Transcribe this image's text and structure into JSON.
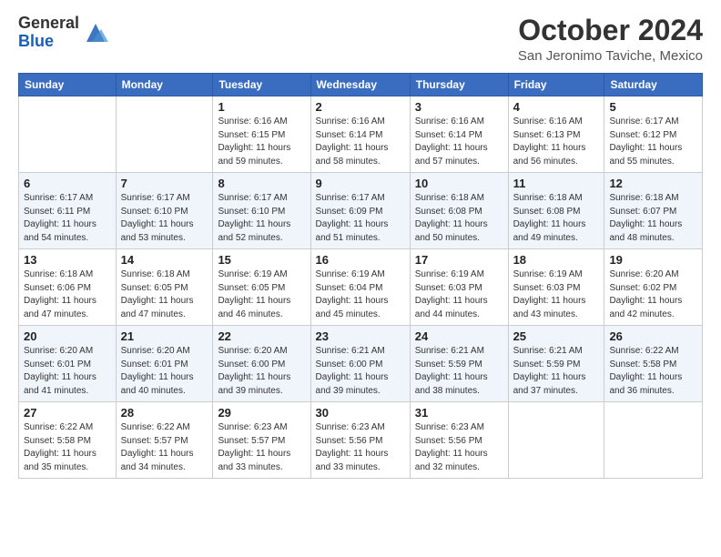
{
  "header": {
    "logo_general": "General",
    "logo_blue": "Blue",
    "month": "October 2024",
    "location": "San Jeronimo Taviche, Mexico"
  },
  "days_of_week": [
    "Sunday",
    "Monday",
    "Tuesday",
    "Wednesday",
    "Thursday",
    "Friday",
    "Saturday"
  ],
  "weeks": [
    [
      {
        "day": "",
        "info": ""
      },
      {
        "day": "",
        "info": ""
      },
      {
        "day": "1",
        "info": "Sunrise: 6:16 AM\nSunset: 6:15 PM\nDaylight: 11 hours and 59 minutes."
      },
      {
        "day": "2",
        "info": "Sunrise: 6:16 AM\nSunset: 6:14 PM\nDaylight: 11 hours and 58 minutes."
      },
      {
        "day": "3",
        "info": "Sunrise: 6:16 AM\nSunset: 6:14 PM\nDaylight: 11 hours and 57 minutes."
      },
      {
        "day": "4",
        "info": "Sunrise: 6:16 AM\nSunset: 6:13 PM\nDaylight: 11 hours and 56 minutes."
      },
      {
        "day": "5",
        "info": "Sunrise: 6:17 AM\nSunset: 6:12 PM\nDaylight: 11 hours and 55 minutes."
      }
    ],
    [
      {
        "day": "6",
        "info": "Sunrise: 6:17 AM\nSunset: 6:11 PM\nDaylight: 11 hours and 54 minutes."
      },
      {
        "day": "7",
        "info": "Sunrise: 6:17 AM\nSunset: 6:10 PM\nDaylight: 11 hours and 53 minutes."
      },
      {
        "day": "8",
        "info": "Sunrise: 6:17 AM\nSunset: 6:10 PM\nDaylight: 11 hours and 52 minutes."
      },
      {
        "day": "9",
        "info": "Sunrise: 6:17 AM\nSunset: 6:09 PM\nDaylight: 11 hours and 51 minutes."
      },
      {
        "day": "10",
        "info": "Sunrise: 6:18 AM\nSunset: 6:08 PM\nDaylight: 11 hours and 50 minutes."
      },
      {
        "day": "11",
        "info": "Sunrise: 6:18 AM\nSunset: 6:08 PM\nDaylight: 11 hours and 49 minutes."
      },
      {
        "day": "12",
        "info": "Sunrise: 6:18 AM\nSunset: 6:07 PM\nDaylight: 11 hours and 48 minutes."
      }
    ],
    [
      {
        "day": "13",
        "info": "Sunrise: 6:18 AM\nSunset: 6:06 PM\nDaylight: 11 hours and 47 minutes."
      },
      {
        "day": "14",
        "info": "Sunrise: 6:18 AM\nSunset: 6:05 PM\nDaylight: 11 hours and 47 minutes."
      },
      {
        "day": "15",
        "info": "Sunrise: 6:19 AM\nSunset: 6:05 PM\nDaylight: 11 hours and 46 minutes."
      },
      {
        "day": "16",
        "info": "Sunrise: 6:19 AM\nSunset: 6:04 PM\nDaylight: 11 hours and 45 minutes."
      },
      {
        "day": "17",
        "info": "Sunrise: 6:19 AM\nSunset: 6:03 PM\nDaylight: 11 hours and 44 minutes."
      },
      {
        "day": "18",
        "info": "Sunrise: 6:19 AM\nSunset: 6:03 PM\nDaylight: 11 hours and 43 minutes."
      },
      {
        "day": "19",
        "info": "Sunrise: 6:20 AM\nSunset: 6:02 PM\nDaylight: 11 hours and 42 minutes."
      }
    ],
    [
      {
        "day": "20",
        "info": "Sunrise: 6:20 AM\nSunset: 6:01 PM\nDaylight: 11 hours and 41 minutes."
      },
      {
        "day": "21",
        "info": "Sunrise: 6:20 AM\nSunset: 6:01 PM\nDaylight: 11 hours and 40 minutes."
      },
      {
        "day": "22",
        "info": "Sunrise: 6:20 AM\nSunset: 6:00 PM\nDaylight: 11 hours and 39 minutes."
      },
      {
        "day": "23",
        "info": "Sunrise: 6:21 AM\nSunset: 6:00 PM\nDaylight: 11 hours and 39 minutes."
      },
      {
        "day": "24",
        "info": "Sunrise: 6:21 AM\nSunset: 5:59 PM\nDaylight: 11 hours and 38 minutes."
      },
      {
        "day": "25",
        "info": "Sunrise: 6:21 AM\nSunset: 5:59 PM\nDaylight: 11 hours and 37 minutes."
      },
      {
        "day": "26",
        "info": "Sunrise: 6:22 AM\nSunset: 5:58 PM\nDaylight: 11 hours and 36 minutes."
      }
    ],
    [
      {
        "day": "27",
        "info": "Sunrise: 6:22 AM\nSunset: 5:58 PM\nDaylight: 11 hours and 35 minutes."
      },
      {
        "day": "28",
        "info": "Sunrise: 6:22 AM\nSunset: 5:57 PM\nDaylight: 11 hours and 34 minutes."
      },
      {
        "day": "29",
        "info": "Sunrise: 6:23 AM\nSunset: 5:57 PM\nDaylight: 11 hours and 33 minutes."
      },
      {
        "day": "30",
        "info": "Sunrise: 6:23 AM\nSunset: 5:56 PM\nDaylight: 11 hours and 33 minutes."
      },
      {
        "day": "31",
        "info": "Sunrise: 6:23 AM\nSunset: 5:56 PM\nDaylight: 11 hours and 32 minutes."
      },
      {
        "day": "",
        "info": ""
      },
      {
        "day": "",
        "info": ""
      }
    ]
  ]
}
